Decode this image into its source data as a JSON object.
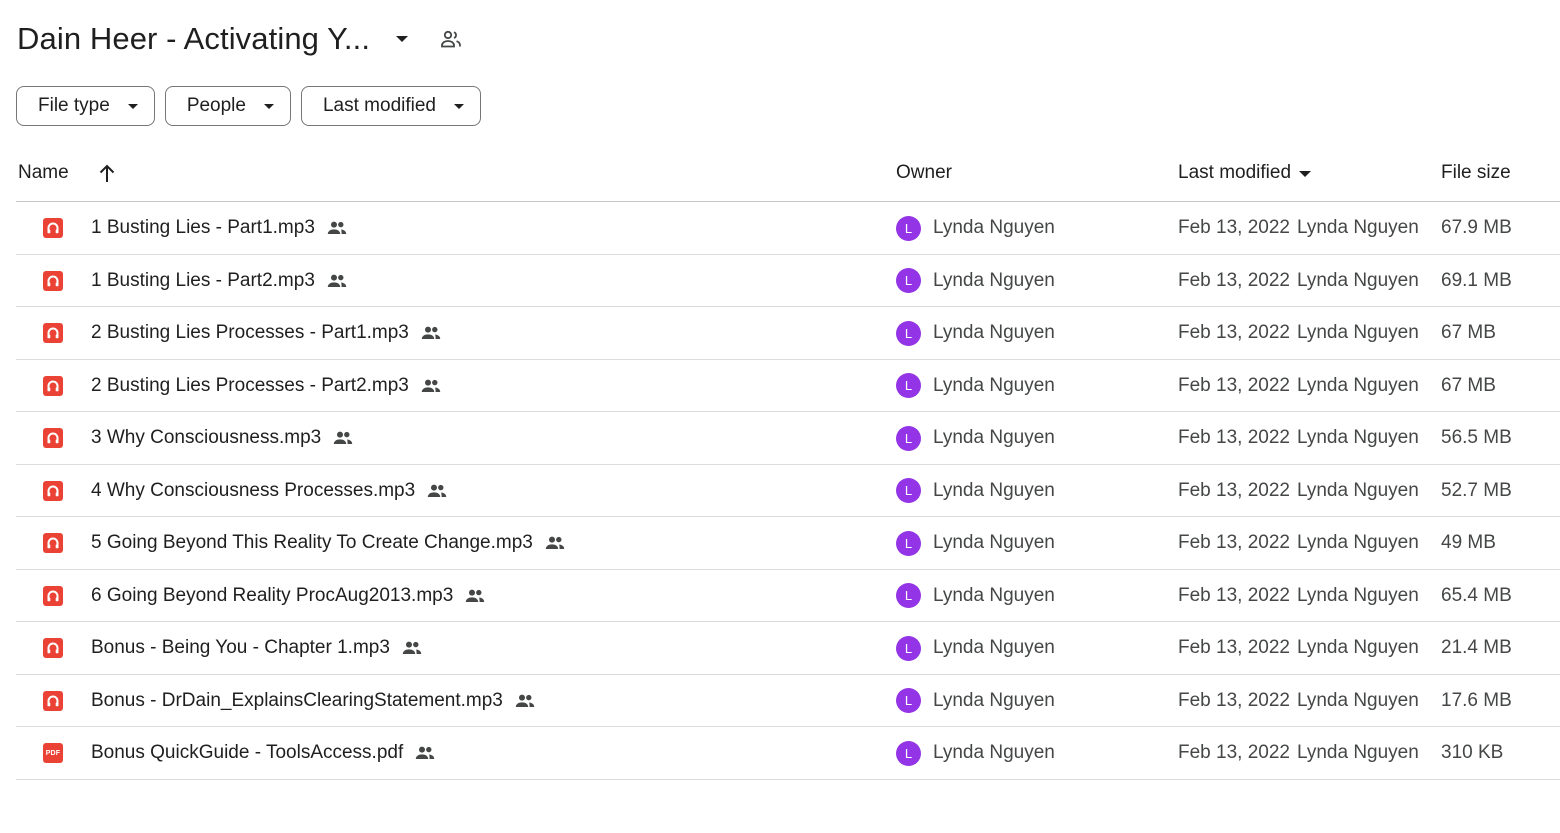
{
  "header": {
    "folder_title": "Dain Heer - Activating Y...",
    "title_dropdown_icon": "arrow-drop-down-icon",
    "shared_icon": "people-outline-icon"
  },
  "filters": [
    {
      "label": "File type"
    },
    {
      "label": "People"
    },
    {
      "label": "Last modified"
    }
  ],
  "columns": {
    "name": "Name",
    "owner": "Owner",
    "last_modified": "Last modified",
    "file_size": "File size",
    "sort_icon": "arrow-upward-icon"
  },
  "colors": {
    "audio_icon": "#ea4335",
    "pdf_icon": "#ea4335",
    "avatar": "#9334e6"
  },
  "files": [
    {
      "name": "1 Busting Lies - Part1.mp3",
      "type": "audio",
      "owner": "Lynda Nguyen",
      "avatar_letter": "L",
      "modified_date": "Feb 13, 2022",
      "modified_by": "Lynda Nguyen",
      "size": "67.9 MB"
    },
    {
      "name": "1 Busting Lies - Part2.mp3",
      "type": "audio",
      "owner": "Lynda Nguyen",
      "avatar_letter": "L",
      "modified_date": "Feb 13, 2022",
      "modified_by": "Lynda Nguyen",
      "size": "69.1 MB"
    },
    {
      "name": "2 Busting Lies Processes - Part1.mp3",
      "type": "audio",
      "owner": "Lynda Nguyen",
      "avatar_letter": "L",
      "modified_date": "Feb 13, 2022",
      "modified_by": "Lynda Nguyen",
      "size": "67 MB"
    },
    {
      "name": "2 Busting Lies Processes - Part2.mp3",
      "type": "audio",
      "owner": "Lynda Nguyen",
      "avatar_letter": "L",
      "modified_date": "Feb 13, 2022",
      "modified_by": "Lynda Nguyen",
      "size": "67 MB"
    },
    {
      "name": "3 Why Consciousness.mp3",
      "type": "audio",
      "owner": "Lynda Nguyen",
      "avatar_letter": "L",
      "modified_date": "Feb 13, 2022",
      "modified_by": "Lynda Nguyen",
      "size": "56.5 MB"
    },
    {
      "name": "4 Why Consciousness Processes.mp3",
      "type": "audio",
      "owner": "Lynda Nguyen",
      "avatar_letter": "L",
      "modified_date": "Feb 13, 2022",
      "modified_by": "Lynda Nguyen",
      "size": "52.7 MB"
    },
    {
      "name": "5 Going Beyond This Reality To Create Change.mp3",
      "type": "audio",
      "owner": "Lynda Nguyen",
      "avatar_letter": "L",
      "modified_date": "Feb 13, 2022",
      "modified_by": "Lynda Nguyen",
      "size": "49 MB"
    },
    {
      "name": "6 Going Beyond Reality ProcAug2013.mp3",
      "type": "audio",
      "owner": "Lynda Nguyen",
      "avatar_letter": "L",
      "modified_date": "Feb 13, 2022",
      "modified_by": "Lynda Nguyen",
      "size": "65.4 MB"
    },
    {
      "name": "Bonus - Being You - Chapter 1.mp3",
      "type": "audio",
      "owner": "Lynda Nguyen",
      "avatar_letter": "L",
      "modified_date": "Feb 13, 2022",
      "modified_by": "Lynda Nguyen",
      "size": "21.4 MB"
    },
    {
      "name": "Bonus - DrDain_ExplainsClearingStatement.mp3",
      "type": "audio",
      "owner": "Lynda Nguyen",
      "avatar_letter": "L",
      "modified_date": "Feb 13, 2022",
      "modified_by": "Lynda Nguyen",
      "size": "17.6 MB"
    },
    {
      "name": "Bonus QuickGuide - ToolsAccess.pdf",
      "type": "pdf",
      "pdf_badge": "PDF",
      "owner": "Lynda Nguyen",
      "avatar_letter": "L",
      "modified_date": "Feb 13, 2022",
      "modified_by": "Lynda Nguyen",
      "size": "310 KB"
    }
  ]
}
